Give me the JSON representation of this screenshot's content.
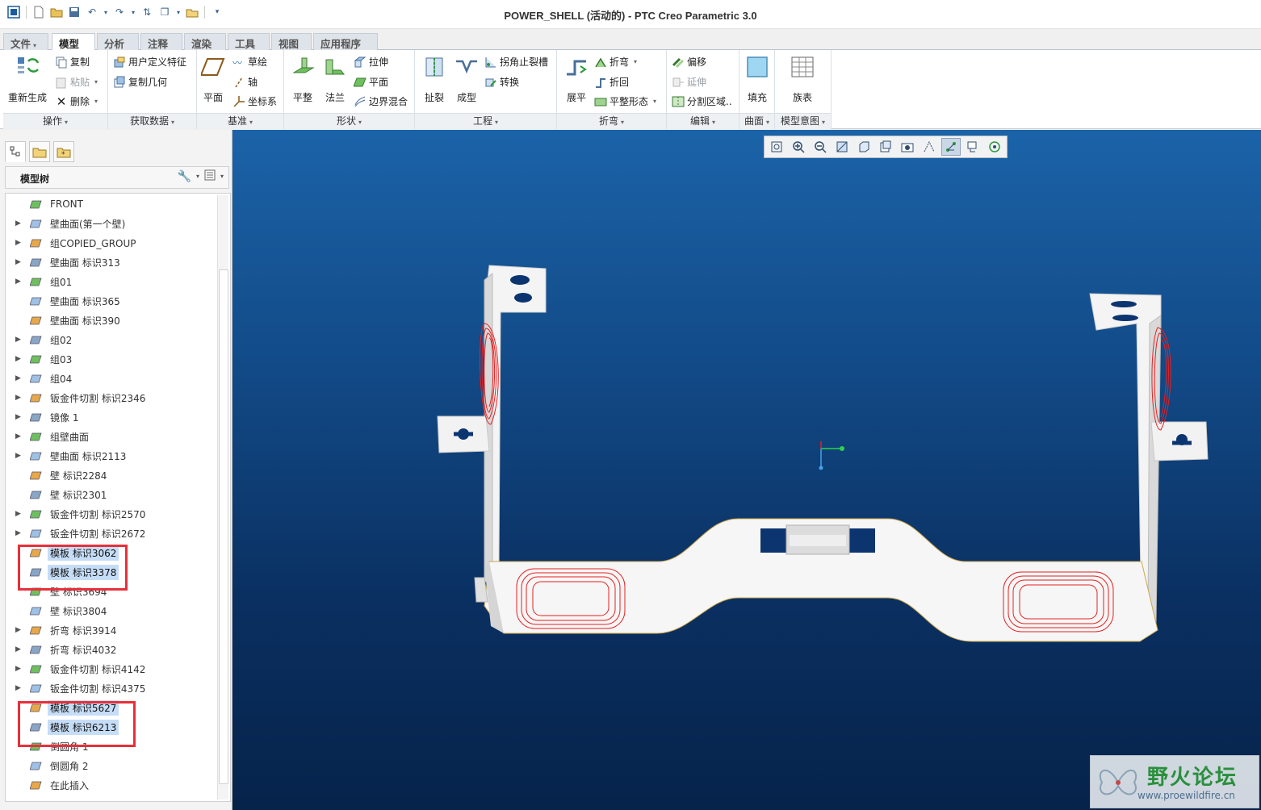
{
  "window": {
    "title": "POWER_SHELL (活动的) - PTC Creo Parametric 3.0"
  },
  "menu_tabs": [
    "文件",
    "模型",
    "分析",
    "注释",
    "渲染",
    "工具",
    "视图",
    "应用程序"
  ],
  "ribbon": {
    "groups": [
      "操作",
      "获取数据",
      "基准",
      "形状",
      "工程",
      "折弯",
      "编辑",
      "曲面",
      "模型意图"
    ],
    "ops": {
      "regen": "重新生成",
      "copy": "复制",
      "paste": "粘贴",
      "delete": "删除"
    },
    "getdata": {
      "udf": "用户定义特征",
      "copygeom": "复制几何"
    },
    "datum": {
      "plane": "平面",
      "sketch": "草绘",
      "axis": "轴",
      "csys": "坐标系"
    },
    "shape": {
      "flat": "平整",
      "flange": "法兰",
      "extrude": "拉伸",
      "planar": "平面",
      "blend": "边界混合"
    },
    "eng": {
      "rip": "扯裂",
      "form": "成型",
      "relief": "拐角止裂槽",
      "convert": "转换"
    },
    "bend": {
      "unbend": "展平",
      "bend": "折弯",
      "bendback": "折回",
      "flatform": "平整形态"
    },
    "edit": {
      "offset": "偏移",
      "extend": "延伸",
      "split": "分割区域.."
    },
    "surface": {
      "fill": "填充"
    },
    "intent": {
      "family": "族表"
    }
  },
  "tree": {
    "header": "模型树",
    "items": [
      {
        "label": "FRONT",
        "expand": false,
        "selected": false
      },
      {
        "label": "壁曲面(第一个壁)",
        "expand": true,
        "selected": false
      },
      {
        "label": "组COPIED_GROUP",
        "expand": true,
        "selected": false
      },
      {
        "label": "壁曲面 标识313",
        "expand": true,
        "selected": false
      },
      {
        "label": "组01",
        "expand": true,
        "selected": false
      },
      {
        "label": "壁曲面 标识365",
        "expand": false,
        "selected": false
      },
      {
        "label": "壁曲面 标识390",
        "expand": false,
        "selected": false
      },
      {
        "label": "组02",
        "expand": true,
        "selected": false
      },
      {
        "label": "组03",
        "expand": true,
        "selected": false
      },
      {
        "label": "组04",
        "expand": true,
        "selected": false
      },
      {
        "label": "钣金件切割 标识2346",
        "expand": true,
        "selected": false
      },
      {
        "label": "镜像 1",
        "expand": true,
        "selected": false
      },
      {
        "label": "组壁曲面",
        "expand": true,
        "selected": false
      },
      {
        "label": "壁曲面 标识2113",
        "expand": true,
        "selected": false
      },
      {
        "label": "壁 标识2284",
        "expand": false,
        "selected": false
      },
      {
        "label": "壁 标识2301",
        "expand": false,
        "selected": false
      },
      {
        "label": "钣金件切割 标识2570",
        "expand": true,
        "selected": false
      },
      {
        "label": "钣金件切割 标识2672",
        "expand": true,
        "selected": false
      },
      {
        "label": "模板 标识3062",
        "expand": false,
        "selected": true
      },
      {
        "label": "模板 标识3378",
        "expand": false,
        "selected": true
      },
      {
        "label": "壁 标识3694",
        "expand": false,
        "selected": false
      },
      {
        "label": "壁 标识3804",
        "expand": false,
        "selected": false
      },
      {
        "label": "折弯 标识3914",
        "expand": true,
        "selected": false
      },
      {
        "label": "折弯 标识4032",
        "expand": true,
        "selected": false
      },
      {
        "label": "钣金件切割 标识4142",
        "expand": true,
        "selected": false
      },
      {
        "label": "钣金件切割 标识4375",
        "expand": true,
        "selected": false
      },
      {
        "label": "模板 标识5627",
        "expand": false,
        "selected": true
      },
      {
        "label": "模板 标识6213",
        "expand": false,
        "selected": true
      },
      {
        "label": "倒圆角 1",
        "expand": false,
        "selected": false
      },
      {
        "label": "倒圆角 2",
        "expand": false,
        "selected": false
      },
      {
        "label": "在此插入",
        "expand": false,
        "selected": false
      }
    ]
  },
  "watermark": {
    "title": "野火论坛",
    "url": "www.proewildfire.cn"
  },
  "colors": {
    "viewport_top": "#1b63a8",
    "viewport_bottom": "#06234a",
    "highlight": "#e8303a",
    "selection": "#c6ddf7"
  }
}
